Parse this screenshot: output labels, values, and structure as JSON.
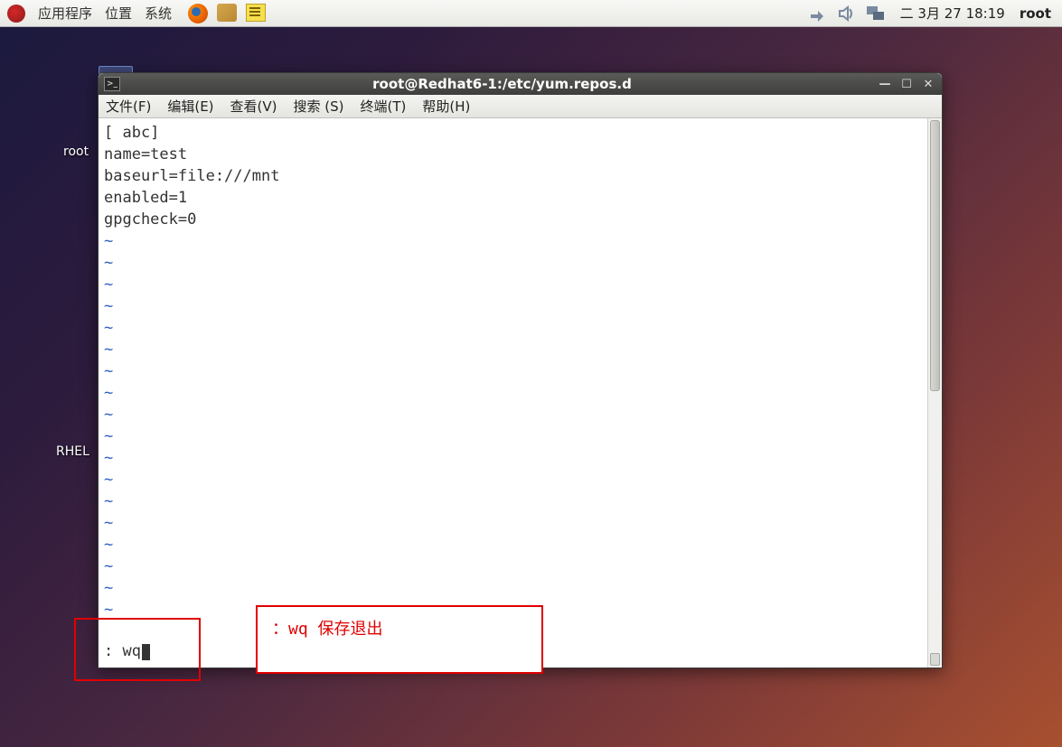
{
  "taskbar": {
    "menus": [
      "应用程序",
      "位置",
      "系统"
    ],
    "datetime": "二  3月 27 18:19",
    "user": "root"
  },
  "desktop": {
    "label_root": "root",
    "label_rhel": "RHEL"
  },
  "window": {
    "title": "root@Redhat6-1:/etc/yum.repos.d",
    "menus": [
      "文件(F)",
      "编辑(E)",
      "查看(V)",
      "搜索 (S)",
      "终端(T)",
      "帮助(H)"
    ]
  },
  "terminal": {
    "lines": [
      "[ abc]",
      "name=test",
      "baseurl=file:///mnt",
      "enabled=1",
      "gpgcheck=0"
    ],
    "vim_cmd": ": wq"
  },
  "annotation": {
    "text": "：wq  保存退出"
  }
}
